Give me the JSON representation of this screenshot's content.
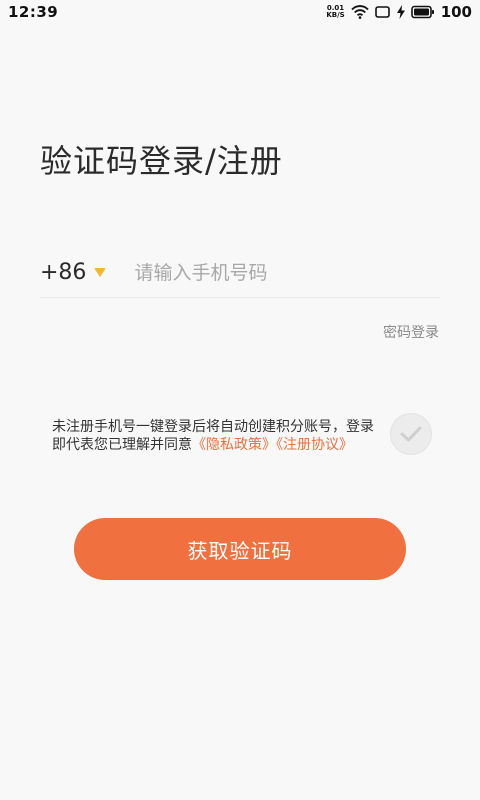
{
  "status_bar": {
    "time": "12:39",
    "net_speed_value": "0.01",
    "net_speed_unit": "KB/S",
    "battery": "100",
    "icons": [
      "wifi-icon",
      "screen-icon",
      "charging-icon",
      "battery-icon"
    ]
  },
  "title": "验证码登录/注册",
  "phone": {
    "country_code": "+86",
    "placeholder": "请输入手机号码",
    "value": ""
  },
  "password_login_label": "密码登录",
  "agreement": {
    "text": "未注册手机号一键登录后将自动创建积分账号，登录即代表您已理解并同意",
    "privacy_link": "《隐私政策》",
    "terms_link": "《注册协议》",
    "checked": false
  },
  "submit_label": "获取验证码",
  "colors": {
    "accent": "#f07040",
    "link": "#ee6f3d",
    "caret": "#f7b731",
    "background": "#f8f8f8"
  }
}
